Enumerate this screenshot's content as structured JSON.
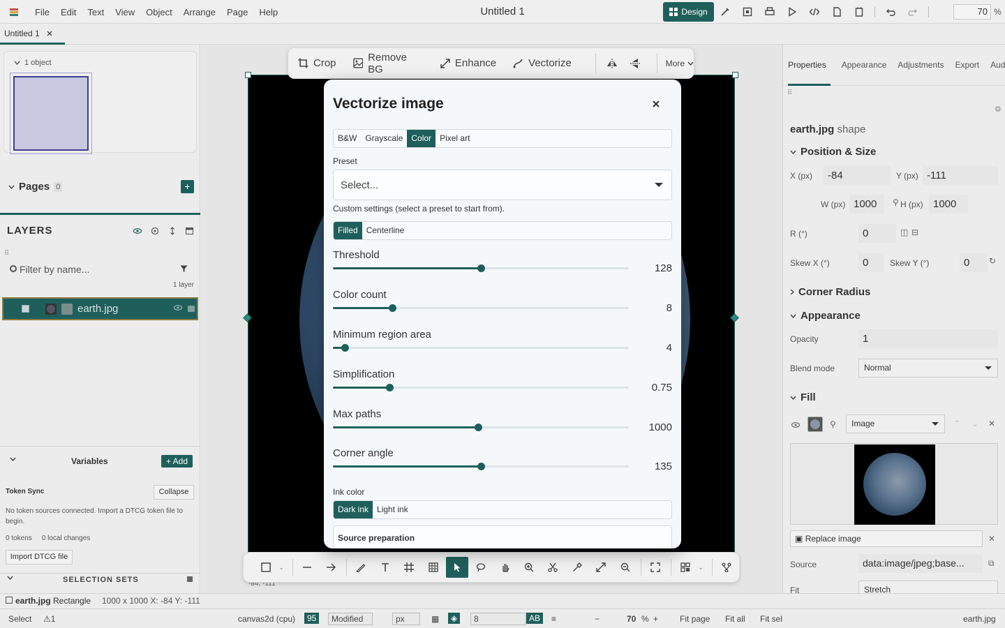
{
  "app": {
    "doc_title": "Untitled 1",
    "menu": [
      "File",
      "Edit",
      "Text",
      "View",
      "Object",
      "Arrange",
      "Page",
      "Help"
    ],
    "design_label": "Design",
    "zoom_value": "70",
    "zoom_unit": "%"
  },
  "tabs": {
    "doc_tab": "Untitled 1"
  },
  "left_panel": {
    "object_count": "1 object",
    "pages_title": "Pages",
    "pages_count": "0",
    "pages_add": "+",
    "layers_title": "LAYERS",
    "filter_placeholder": "Filter by name...",
    "layer_count": "1 layer",
    "layer_name": "earth.jpg",
    "variables_title": "Variables",
    "variables_add": "+ Add",
    "token_sync_title": "Token Sync",
    "collapse_label": "Collapse",
    "token_message": "No token sources connected. Import a DTCG token file to begin.",
    "tokens": "0 tokens",
    "local_changes": "0 local changes",
    "import_label": "Import DTCG file",
    "selection_sets_title": "SELECTION SETS"
  },
  "image_toolbar": {
    "crop": "Crop",
    "remove_bg": "Remove BG",
    "enhance": "Enhance",
    "vectorize": "Vectorize",
    "more": "More"
  },
  "canvas": {
    "coord_readout": "-84, -111"
  },
  "modal": {
    "title": "Vectorize image",
    "modes": [
      "B&W",
      "Grayscale",
      "Color",
      "Pixel art"
    ],
    "active_mode": "Color",
    "preset_label": "Preset",
    "preset_value": "Select...",
    "custom_hint": "Custom settings (select a preset to start from).",
    "path_modes": [
      "Filled",
      "Centerline"
    ],
    "active_path_mode": "Filled",
    "sliders": [
      {
        "label": "Threshold",
        "value": "128",
        "fraction": 0.5
      },
      {
        "label": "Color count",
        "value": "8",
        "fraction": 0.2
      },
      {
        "label": "Minimum region area",
        "value": "4",
        "fraction": 0.04
      },
      {
        "label": "Simplification",
        "value": "0.75",
        "fraction": 0.19
      },
      {
        "label": "Max paths",
        "value": "1000",
        "fraction": 0.49
      },
      {
        "label": "Corner angle",
        "value": "135",
        "fraction": 0.5
      }
    ],
    "ink_label": "Ink color",
    "ink_options": [
      "Dark ink",
      "Light ink"
    ],
    "active_ink": "Dark ink",
    "source_prep": "Source preparation"
  },
  "right_panel": {
    "tabs": [
      "Properties",
      "Appearance",
      "Adjustments",
      "Export",
      "Audit"
    ],
    "active_tab": "Properties",
    "object_name": "earth.jpg",
    "object_kind": "shape",
    "position_size_title": "Position & Size",
    "x_label": "X (px)",
    "x_value": "-84",
    "y_label": "Y (px)",
    "y_value": "-111",
    "w_label": "W (px)",
    "w_value": "1000",
    "h_label": "H (px)",
    "h_value": "1000",
    "r_label": "R (°)",
    "r_value": "0",
    "skewx_label": "Skew X (°)",
    "skewx_value": "0",
    "skewy_label": "Skew Y (°)",
    "skewy_value": "0",
    "corner_radius_title": "Corner Radius",
    "appearance_title": "Appearance",
    "opacity_label": "Opacity",
    "opacity_value": "1",
    "blend_label": "Blend mode",
    "blend_value": "Normal",
    "fill_title": "Fill",
    "fill_type": "Image",
    "replace_label": "Replace image",
    "source_label": "Source",
    "source_value": "data:image/jpeg;base...",
    "fit_label": "Fit",
    "fit_value": "Stretch"
  },
  "selection_status": {
    "name": "earth.jpg",
    "kind": "Rectangle",
    "details": "1000 x 1000 X: -84 Y: -111"
  },
  "status_bar": {
    "mode": "Select",
    "warnings": "1",
    "renderer": "canvas2d (cpu)",
    "score": "95",
    "modified": "Modified",
    "unit": "px",
    "grid_size": "8",
    "ab": "AB",
    "zoom": "70",
    "zoom_unit": "%",
    "fit_page": "Fit page",
    "fit_all": "Fit all",
    "fit_sel": "Fit sel",
    "file": "earth.jpg"
  },
  "colors": {
    "accent": "#1f5f5b",
    "modal_bg": "#f4f8fb"
  }
}
